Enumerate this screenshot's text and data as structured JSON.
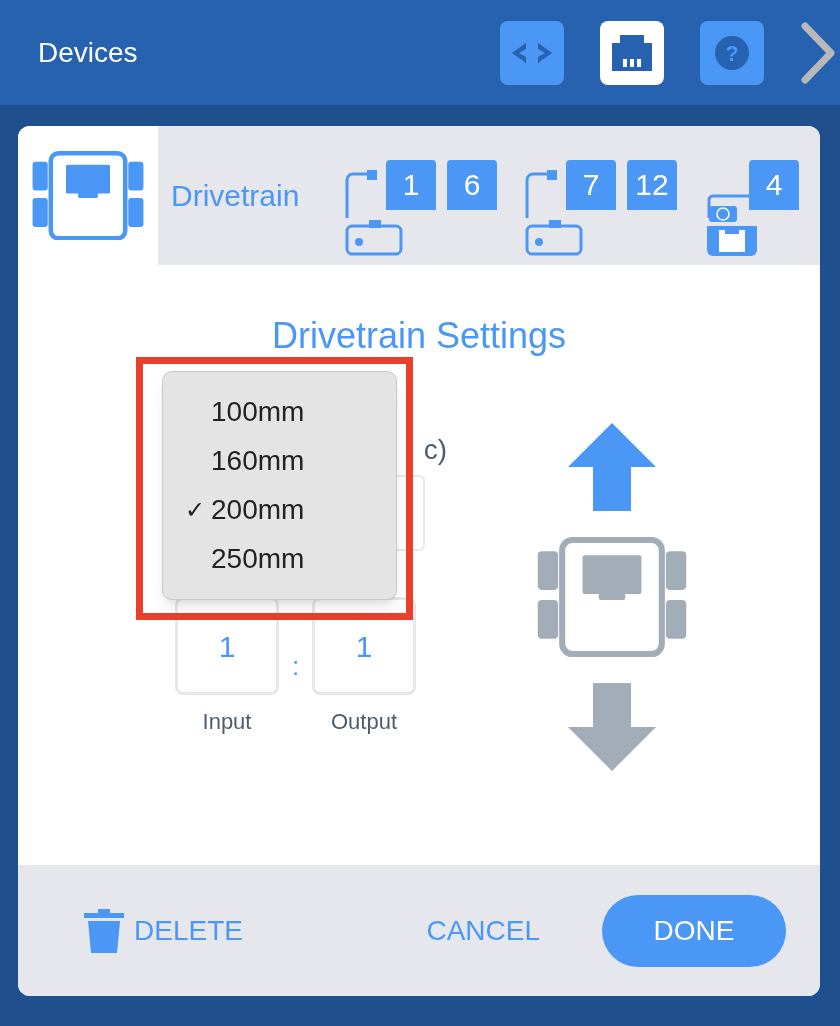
{
  "header": {
    "title": "Devices",
    "buttons": [
      {
        "kind": "code",
        "selected": false
      },
      {
        "kind": "port",
        "selected": true
      },
      {
        "kind": "help",
        "selected": false,
        "glyph": "?"
      }
    ]
  },
  "card": {
    "tabs": [
      {
        "kind": "drivetrain",
        "label": "Drivetrain",
        "selected": true
      }
    ],
    "devices": [
      {
        "kind": "motor-group",
        "ports": [
          "1",
          "6"
        ]
      },
      {
        "kind": "motor-group",
        "ports": [
          "7",
          "12"
        ]
      },
      {
        "kind": "gyro",
        "ports": [
          "4"
        ]
      }
    ],
    "title": "Drivetrain Settings",
    "wheel_size": {
      "label": "c)",
      "options": [
        {
          "label": "100mm",
          "selected": false
        },
        {
          "label": "160mm",
          "selected": false
        },
        {
          "label": "200mm",
          "selected": true
        },
        {
          "label": "250mm",
          "selected": false
        }
      ],
      "check": "✓"
    },
    "gear_ratio": {
      "input": "1",
      "separator": ":",
      "output": "1",
      "input_label": "Input",
      "output_label": "Output"
    },
    "direction": [
      {
        "kind": "forward",
        "selected": true
      },
      {
        "kind": "reverse",
        "selected": false
      }
    ],
    "footer": {
      "delete": "DELETE",
      "cancel": "CANCEL",
      "done": "DONE"
    }
  }
}
